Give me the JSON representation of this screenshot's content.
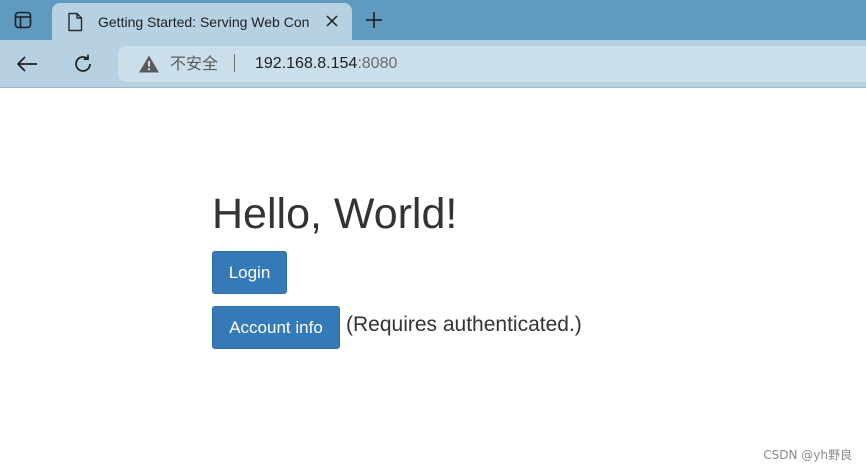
{
  "browser": {
    "tab": {
      "title": "Getting Started: Serving Web Con",
      "favicon": "document-icon",
      "close_icon": "close-icon"
    },
    "tab_actions_icon": "tab-actions-icon",
    "new_tab_icon": "plus-icon",
    "nav": {
      "back_icon": "back-arrow-icon",
      "reload_icon": "reload-icon"
    },
    "address_bar": {
      "security_icon": "warning-icon",
      "security_label": "不安全",
      "host": "192.168.8.154",
      "port": ":8080"
    },
    "colors": {
      "tabstrip": "#5f9bbf",
      "toolbar": "#b6d1e2",
      "omnibox": "#cbdfea"
    }
  },
  "page": {
    "heading": "Hello, World!",
    "login_button": "Login",
    "account_button": "Account info",
    "requires_note": "(Requires authenticated.)",
    "colors": {
      "button": "#337ab7",
      "text": "#333333"
    }
  },
  "watermark": "CSDN @yh野良"
}
